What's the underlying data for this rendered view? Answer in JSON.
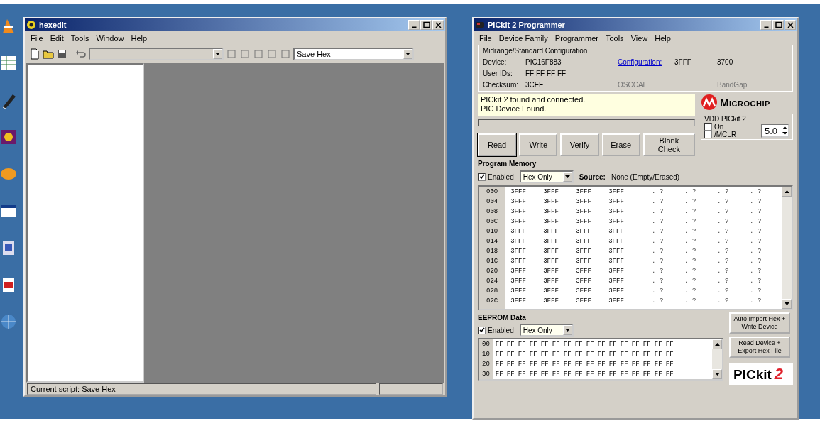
{
  "editor_window": {
    "title": "hexedit",
    "menu": [
      "File",
      "Edit",
      "Tools",
      "Window",
      "Help"
    ],
    "script_combo": "Save Hex",
    "status_bar": "Current script: Save Hex"
  },
  "pickit_window": {
    "title": "PICkit 2 Programmer",
    "menu": [
      "File",
      "Device Family",
      "Programmer",
      "Tools",
      "View",
      "Help"
    ],
    "config_heading": "Midrange/Standard Configuration",
    "device_label": "Device:",
    "device": "PIC16F883",
    "configuration_link": "Configuration:",
    "config_words": [
      "3FFF",
      "3700"
    ],
    "user_ids_label": "User IDs:",
    "user_ids": "FF FF FF FF",
    "checksum_label": "Checksum:",
    "checksum": "3CFF",
    "extra_labels": [
      {
        "text": "OSCCAL",
        "disabled": true
      },
      {
        "text": "BandGap",
        "disabled": true
      }
    ],
    "status_lines": [
      "PICkit 2 found and connected.",
      "PIC Device Found."
    ],
    "progress": {
      "level": 0
    },
    "logo": "Microchip",
    "actions": [
      "Read",
      "Write",
      "Verify",
      "Erase",
      "Blank Check"
    ],
    "vdd": {
      "title": "VDD PICkit 2",
      "on": {
        "label": "On",
        "checked": false
      },
      "mclr": {
        "label": "/MCLR",
        "checked": false
      },
      "voltage": "5.0"
    },
    "program_memory": {
      "title": "Program Memory",
      "enabled": {
        "label": "Enabled",
        "checked": true
      },
      "view": "Hex Only",
      "source": "Source:",
      "source_value": "None (Empty/Erased)",
      "rows": [
        {
          "address": "000",
          "words": [
            "3FFF",
            "3FFF",
            "3FFF",
            "3FFF"
          ],
          "ascii": [
            ". ?",
            ". ?",
            ". ?",
            ". ?"
          ]
        },
        {
          "address": "004",
          "words": [
            "3FFF",
            "3FFF",
            "3FFF",
            "3FFF"
          ],
          "ascii": [
            ". ?",
            ". ?",
            ". ?",
            ". ?"
          ]
        },
        {
          "address": "008",
          "words": [
            "3FFF",
            "3FFF",
            "3FFF",
            "3FFF"
          ],
          "ascii": [
            ". ?",
            ". ?",
            ". ?",
            ". ?"
          ]
        },
        {
          "address": "00C",
          "words": [
            "3FFF",
            "3FFF",
            "3FFF",
            "3FFF"
          ],
          "ascii": [
            ". ?",
            ". ?",
            ". ?",
            ". ?"
          ]
        },
        {
          "address": "010",
          "words": [
            "3FFF",
            "3FFF",
            "3FFF",
            "3FFF"
          ],
          "ascii": [
            ". ?",
            ". ?",
            ". ?",
            ". ?"
          ]
        },
        {
          "address": "014",
          "words": [
            "3FFF",
            "3FFF",
            "3FFF",
            "3FFF"
          ],
          "ascii": [
            ". ?",
            ". ?",
            ". ?",
            ". ?"
          ]
        },
        {
          "address": "018",
          "words": [
            "3FFF",
            "3FFF",
            "3FFF",
            "3FFF"
          ],
          "ascii": [
            ". ?",
            ". ?",
            ". ?",
            ". ?"
          ]
        },
        {
          "address": "01C",
          "words": [
            "3FFF",
            "3FFF",
            "3FFF",
            "3FFF"
          ],
          "ascii": [
            ". ?",
            ". ?",
            ". ?",
            ". ?"
          ]
        },
        {
          "address": "020",
          "words": [
            "3FFF",
            "3FFF",
            "3FFF",
            "3FFF"
          ],
          "ascii": [
            ". ?",
            ". ?",
            ". ?",
            ". ?"
          ]
        },
        {
          "address": "024",
          "words": [
            "3FFF",
            "3FFF",
            "3FFF",
            "3FFF"
          ],
          "ascii": [
            ". ?",
            ". ?",
            ". ?",
            ". ?"
          ]
        },
        {
          "address": "028",
          "words": [
            "3FFF",
            "3FFF",
            "3FFF",
            "3FFF"
          ],
          "ascii": [
            ". ?",
            ". ?",
            ". ?",
            ". ?"
          ]
        },
        {
          "address": "02C",
          "words": [
            "3FFF",
            "3FFF",
            "3FFF",
            "3FFF"
          ],
          "ascii": [
            ". ?",
            ". ?",
            ". ?",
            ". ?"
          ]
        }
      ]
    },
    "eeprom": {
      "title": "EEPROM Data",
      "enabled": {
        "label": "Enabled",
        "checked": true
      },
      "view": "Hex Only",
      "rows": [
        {
          "address": "00",
          "bytes": [
            "FF",
            "FF",
            "FF",
            "FF",
            "FF",
            "FF",
            "FF",
            "FF",
            "FF",
            "FF",
            "FF",
            "FF",
            "FF",
            "FF",
            "FF",
            "FF"
          ]
        },
        {
          "address": "10",
          "bytes": [
            "FF",
            "FF",
            "FF",
            "FF",
            "FF",
            "FF",
            "FF",
            "FF",
            "FF",
            "FF",
            "FF",
            "FF",
            "FF",
            "FF",
            "FF",
            "FF"
          ]
        },
        {
          "address": "20",
          "bytes": [
            "FF",
            "FF",
            "FF",
            "FF",
            "FF",
            "FF",
            "FF",
            "FF",
            "FF",
            "FF",
            "FF",
            "FF",
            "FF",
            "FF",
            "FF",
            "FF"
          ]
        },
        {
          "address": "30",
          "bytes": [
            "FF",
            "FF",
            "FF",
            "FF",
            "FF",
            "FF",
            "FF",
            "FF",
            "FF",
            "FF",
            "FF",
            "FF",
            "FF",
            "FF",
            "FF",
            "FF"
          ]
        }
      ]
    },
    "side_buttons": [
      "Auto Import Hex + Write Device",
      "Read Device + Export Hex File"
    ],
    "brand": "PICkit",
    "brand_number": "2"
  }
}
